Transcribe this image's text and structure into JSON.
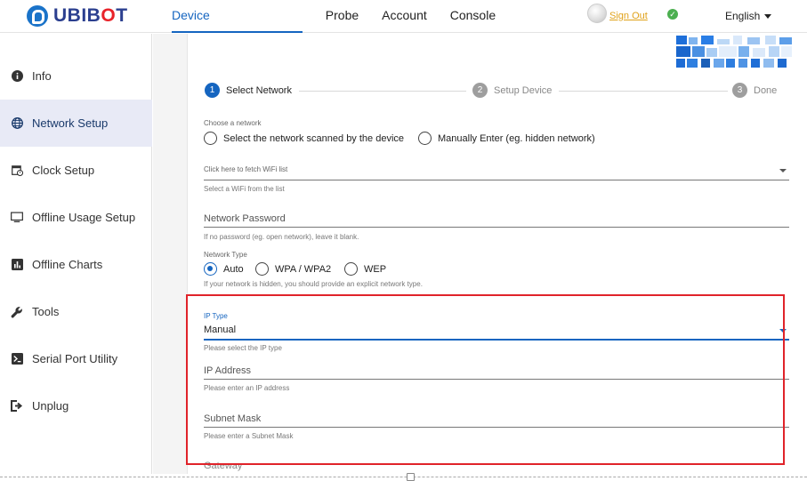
{
  "brand": {
    "name_prefix": "UBIB",
    "name_o": "O",
    "name_suffix": "T"
  },
  "nav": {
    "items": [
      {
        "label": "Device",
        "active": true
      },
      {
        "label": "Probe",
        "active": false
      },
      {
        "label": "Account",
        "active": false
      },
      {
        "label": "Console",
        "active": false
      }
    ],
    "signout": "Sign Out",
    "language": "English"
  },
  "sidebar": {
    "items": [
      {
        "label": "Info",
        "icon": "info-icon"
      },
      {
        "label": "Network Setup",
        "icon": "globe-icon",
        "active": true
      },
      {
        "label": "Clock Setup",
        "icon": "calendar-clock-icon"
      },
      {
        "label": "Offline Usage Setup",
        "icon": "monitor-icon"
      },
      {
        "label": "Offline Charts",
        "icon": "bar-chart-icon"
      },
      {
        "label": "Tools",
        "icon": "wrench-icon"
      },
      {
        "label": "Serial Port Utility",
        "icon": "terminal-icon"
      },
      {
        "label": "Unplug",
        "icon": "sign-out-icon"
      }
    ]
  },
  "stepper": {
    "steps": [
      {
        "num": "1",
        "label": "Select Network",
        "active": true
      },
      {
        "num": "2",
        "label": "Setup Device",
        "active": false
      },
      {
        "num": "3",
        "label": "Done",
        "active": false
      }
    ]
  },
  "form": {
    "choose_label": "Choose a network",
    "choose_options": [
      "Select the network scanned by the device",
      "Manually Enter (eg. hidden network)"
    ],
    "wifi_placeholder": "Click here to fetch WiFi list",
    "wifi_hint": "Select a WiFi from the list",
    "password_placeholder": "Network Password",
    "password_hint": "If no password (eg. open network), leave it blank.",
    "network_type_label": "Network Type",
    "network_type_options": [
      "Auto",
      "WPA / WPA2",
      "WEP"
    ],
    "network_type_selected": "Auto",
    "network_type_hint": "If your network is hidden, you should provide an explicit network type.",
    "ip_type_label": "IP Type",
    "ip_type_value": "Manual",
    "ip_type_hint": "Please select the IP type",
    "ip_address_placeholder": "IP Address",
    "ip_address_hint": "Please enter an IP address",
    "subnet_placeholder": "Subnet Mask",
    "subnet_hint": "Please enter a Subnet Mask",
    "gateway_placeholder": "Gateway"
  },
  "colors": {
    "accent": "#1565c0",
    "highlight_box": "#e0232a",
    "sidebar_active": "#e8eaf6",
    "signout": "#e0a21a"
  }
}
